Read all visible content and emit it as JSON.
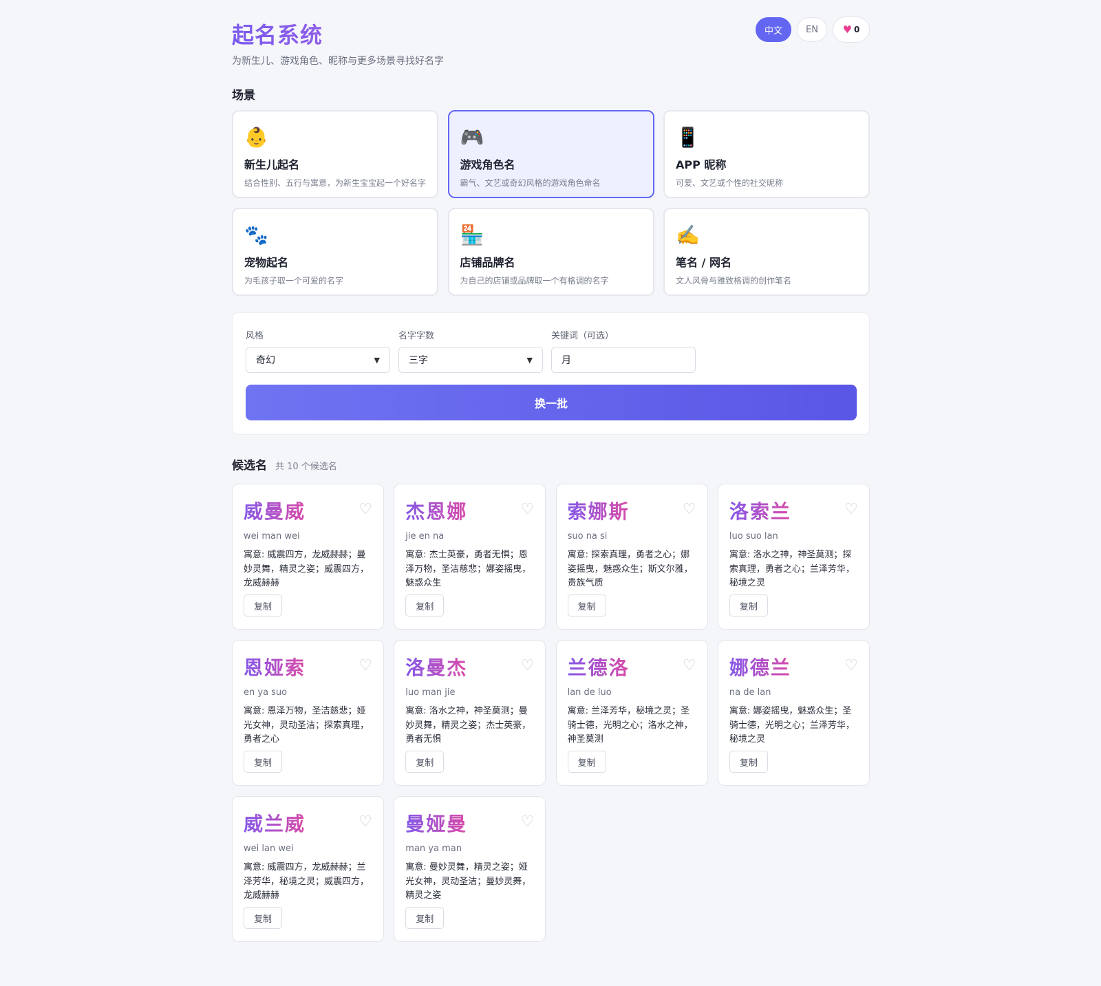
{
  "header": {
    "title": "起名系统",
    "subtitle": "为新生儿、游戏角色、昵称与更多场景寻找好名字",
    "lang_zh": "中文",
    "lang_en": "EN",
    "favorites_count": "0",
    "favorites_icon": "heart-icon"
  },
  "scenes": {
    "title": "场景",
    "items": [
      {
        "emoji": "👶",
        "name": "新生儿起名",
        "desc": "结合性别、五行与寓意，为新生宝宝起一个好名字"
      },
      {
        "emoji": "🎮",
        "name": "游戏角色名",
        "desc": "霸气、文艺或奇幻风格的游戏角色命名",
        "selected": true
      },
      {
        "emoji": "📱",
        "name": "APP 昵称",
        "desc": "可爱、文艺或个性的社交昵称"
      },
      {
        "emoji": "🐾",
        "name": "宠物起名",
        "desc": "为毛孩子取一个可爱的名字"
      },
      {
        "emoji": "🏪",
        "name": "店铺品牌名",
        "desc": "为自己的店铺或品牌取一个有格调的名字"
      },
      {
        "emoji": "✍️",
        "name": "笔名 / 网名",
        "desc": "文人风骨与雅致格调的创作笔名"
      }
    ]
  },
  "form": {
    "style_label": "风格",
    "style_value": "奇幻",
    "length_label": "名字字数",
    "length_value": "三字",
    "keyword_label": "关键词（可选）",
    "keyword_value": "月",
    "generate_label": "换一批"
  },
  "candidates": {
    "title": "候选名",
    "count_text": "共 10 个候选名",
    "copy_label": "复制",
    "items": [
      {
        "name": "威曼威",
        "pinyin": "wei man wei",
        "meaning": "寓意: 威震四方，龙威赫赫；曼妙灵舞，精灵之姿；威震四方，龙威赫赫"
      },
      {
        "name": "杰恩娜",
        "pinyin": "jie en na",
        "meaning": "寓意: 杰士英豪，勇者无惧；恩泽万物，圣洁慈悲；娜姿摇曳，魅惑众生"
      },
      {
        "name": "索娜斯",
        "pinyin": "suo na si",
        "meaning": "寓意: 探索真理，勇者之心；娜姿摇曳，魅惑众生；斯文尔雅，贵族气质"
      },
      {
        "name": "洛索兰",
        "pinyin": "luo suo lan",
        "meaning": "寓意: 洛水之神，神圣莫测；探索真理，勇者之心；兰泽芳华，秘境之灵"
      },
      {
        "name": "恩娅索",
        "pinyin": "en ya suo",
        "meaning": "寓意: 恩泽万物，圣洁慈悲；娅光女神，灵动圣洁；探索真理，勇者之心"
      },
      {
        "name": "洛曼杰",
        "pinyin": "luo man jie",
        "meaning": "寓意: 洛水之神，神圣莫测；曼妙灵舞，精灵之姿；杰士英豪，勇者无惧"
      },
      {
        "name": "兰德洛",
        "pinyin": "lan de luo",
        "meaning": "寓意: 兰泽芳华，秘境之灵；圣骑士德，光明之心；洛水之神，神圣莫测"
      },
      {
        "name": "娜德兰",
        "pinyin": "na de lan",
        "meaning": "寓意: 娜姿摇曳，魅惑众生；圣骑士德，光明之心；兰泽芳华，秘境之灵"
      },
      {
        "name": "威兰威",
        "pinyin": "wei lan wei",
        "meaning": "寓意: 威震四方，龙威赫赫；兰泽芳华，秘境之灵；威震四方，龙威赫赫"
      },
      {
        "name": "曼娅曼",
        "pinyin": "man ya man",
        "meaning": "寓意: 曼妙灵舞，精灵之姿；娅光女神，灵动圣洁；曼妙灵舞，精灵之姿"
      }
    ]
  },
  "colors": {
    "accent": "#6366f1",
    "title_gradient_start": "#7a5af0",
    "name_gradient_start": "#8558e8",
    "name_gradient_end": "#d94aa8",
    "favorite_heart": "#e8408f"
  }
}
